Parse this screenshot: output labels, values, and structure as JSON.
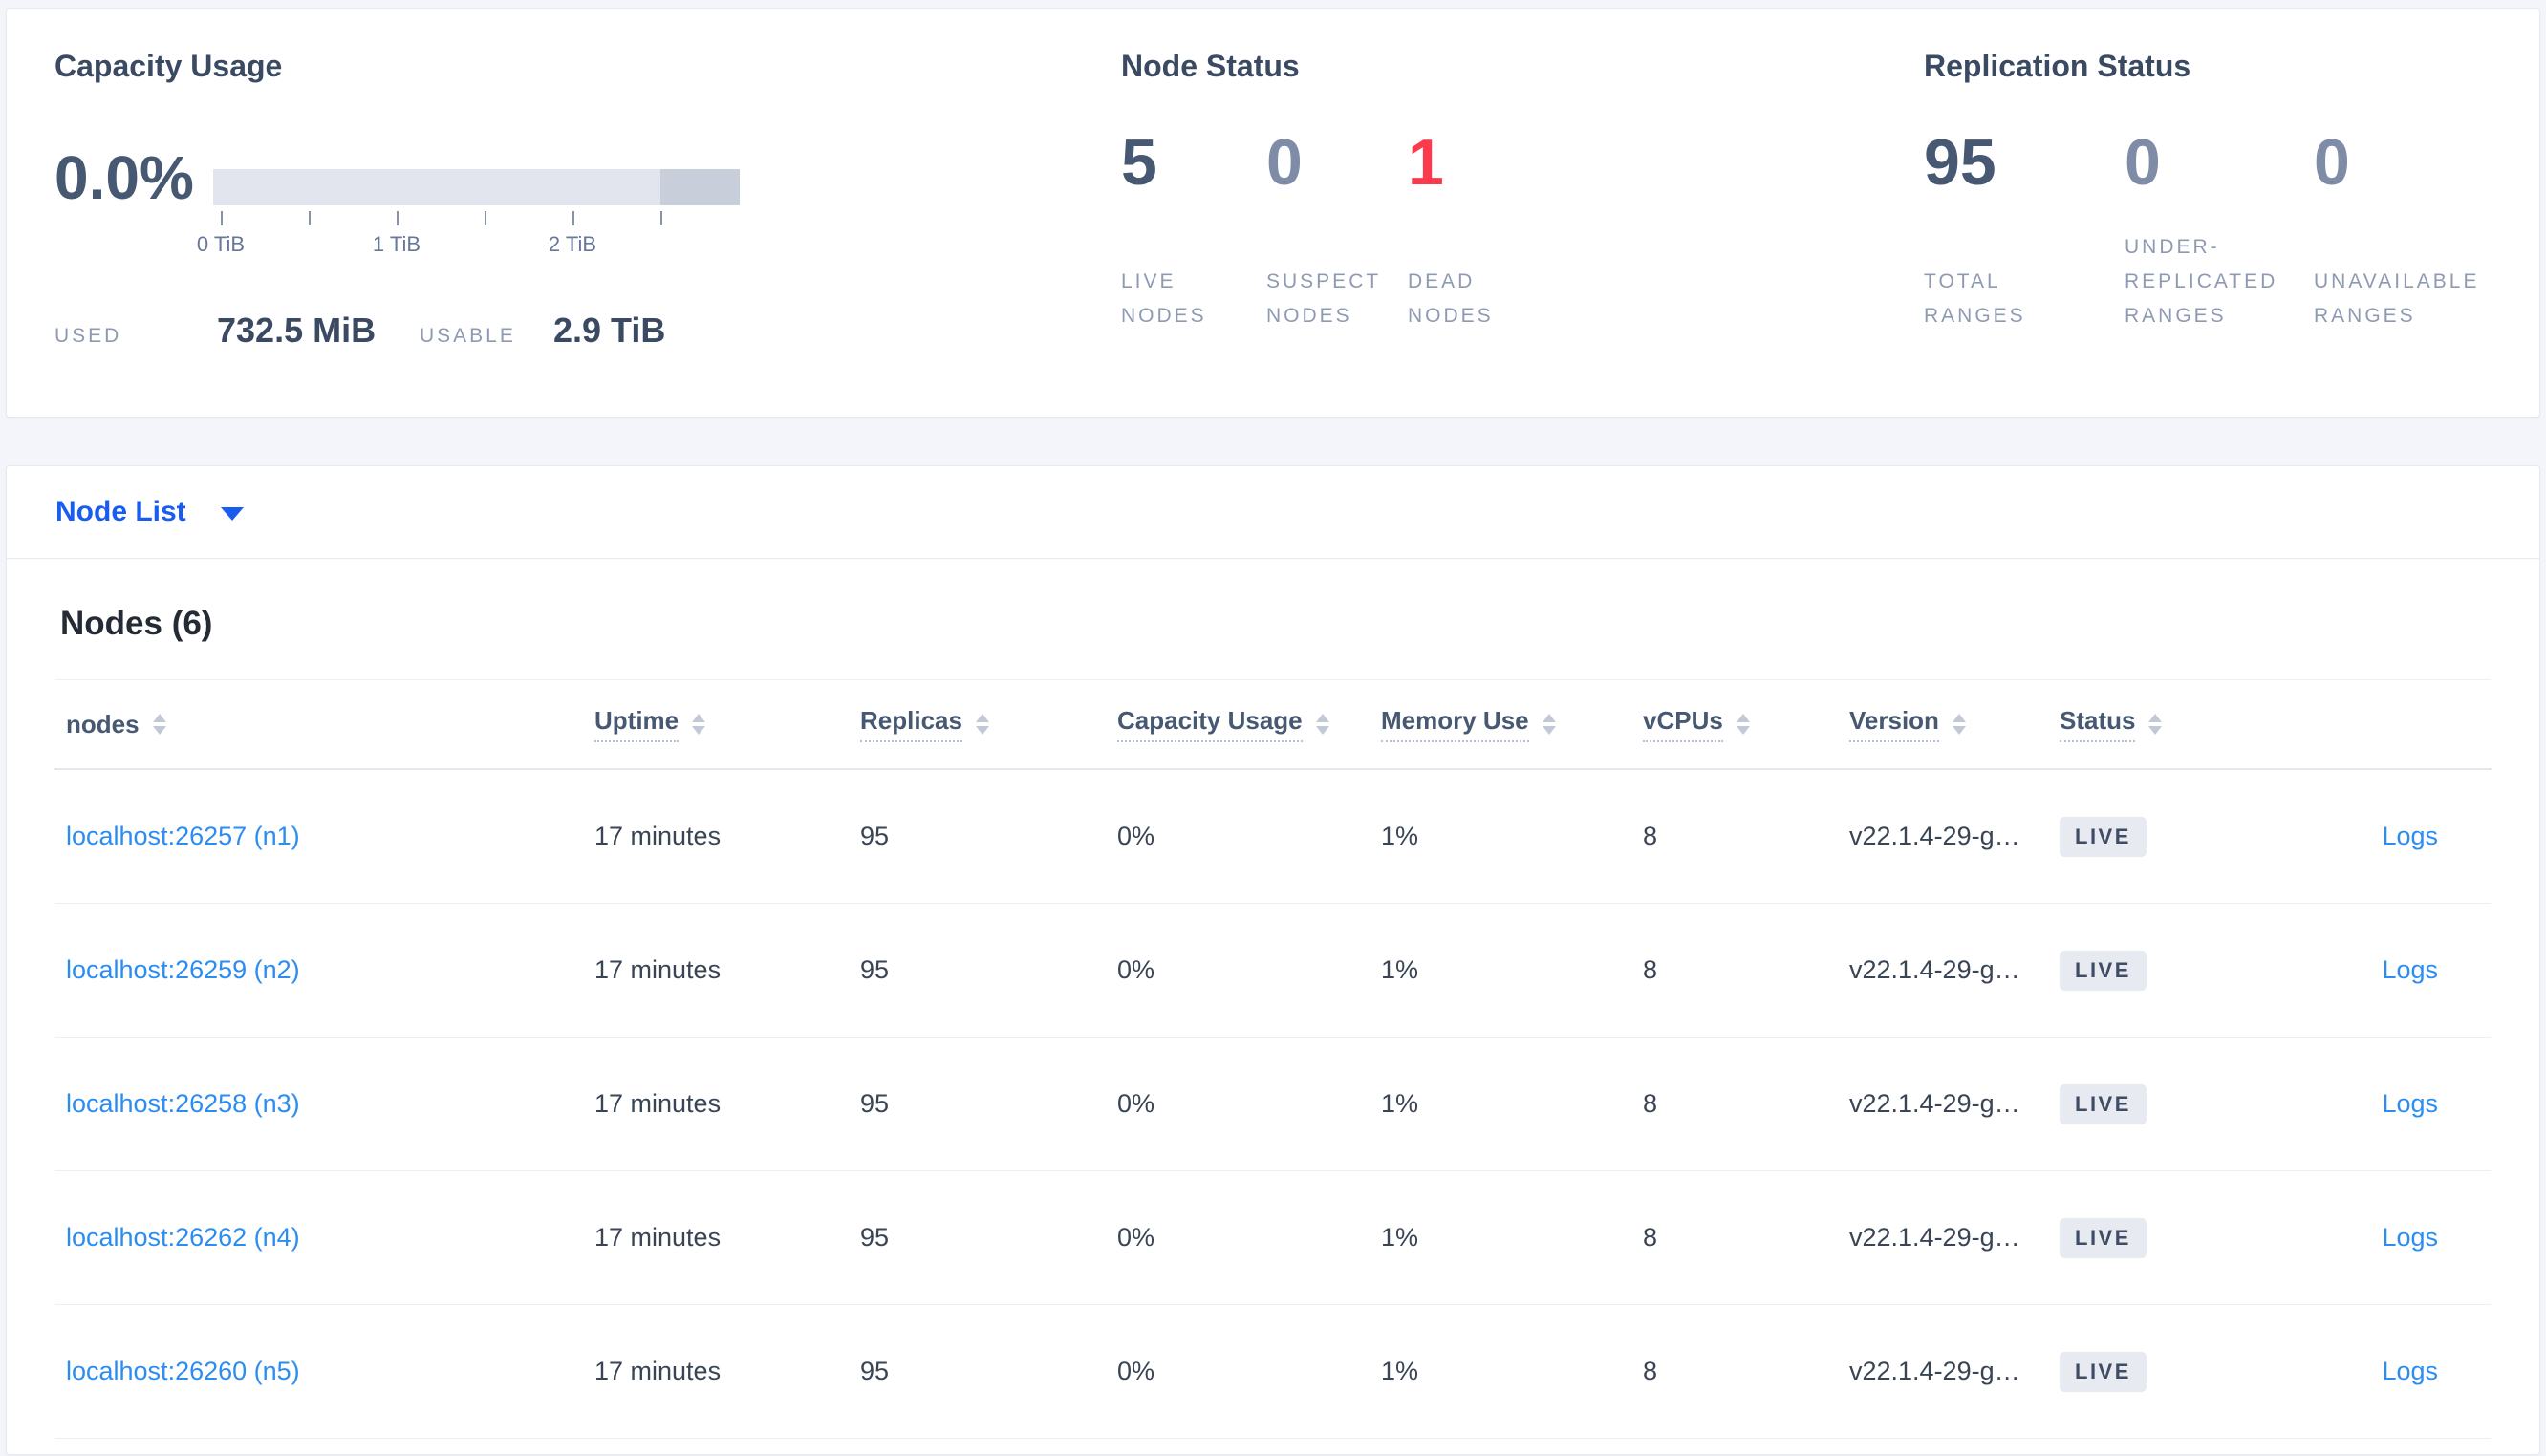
{
  "summary": {
    "capacity": {
      "title": "Capacity Usage",
      "percent": "0.0%",
      "axis_ticks": [
        "0 TiB",
        "1 TiB",
        "2 TiB"
      ],
      "used_label": "USED",
      "used_value": "732.5 MiB",
      "usable_label": "USABLE",
      "usable_value": "2.9 TiB"
    },
    "node_status": {
      "title": "Node Status",
      "stats": [
        {
          "value": "5",
          "label": "LIVE NODES",
          "tone": "dark"
        },
        {
          "value": "0",
          "label": "SUSPECT NODES",
          "tone": "muted"
        },
        {
          "value": "1",
          "label": "DEAD NODES",
          "tone": "danger"
        }
      ]
    },
    "replication_status": {
      "title": "Replication Status",
      "stats": [
        {
          "value": "95",
          "label": "TOTAL RANGES",
          "tone": "dark"
        },
        {
          "value": "0",
          "label": "UNDER-REPLICATED RANGES",
          "tone": "muted"
        },
        {
          "value": "0",
          "label": "UNAVAILABLE RANGES",
          "tone": "muted"
        }
      ]
    }
  },
  "node_list_dropdown": {
    "label": "Node List"
  },
  "nodes_table": {
    "title": "Nodes (6)",
    "columns": [
      {
        "label": "nodes",
        "underline": false
      },
      {
        "label": "Uptime",
        "underline": true
      },
      {
        "label": "Replicas",
        "underline": true
      },
      {
        "label": "Capacity Usage",
        "underline": true
      },
      {
        "label": "Memory Use",
        "underline": true
      },
      {
        "label": "vCPUs",
        "underline": true
      },
      {
        "label": "Version",
        "underline": true
      },
      {
        "label": "Status",
        "underline": true
      }
    ],
    "rows": [
      {
        "node": "localhost:26257 (n1)",
        "uptime": "17 minutes",
        "replicas": "95",
        "capacity_usage": "0%",
        "memory_use": "1%",
        "vcpus": "8",
        "version": "v22.1.4-29-g…",
        "status": "LIVE",
        "logs_label": "Logs"
      },
      {
        "node": "localhost:26259 (n2)",
        "uptime": "17 minutes",
        "replicas": "95",
        "capacity_usage": "0%",
        "memory_use": "1%",
        "vcpus": "8",
        "version": "v22.1.4-29-g…",
        "status": "LIVE",
        "logs_label": "Logs"
      },
      {
        "node": "localhost:26258 (n3)",
        "uptime": "17 minutes",
        "replicas": "95",
        "capacity_usage": "0%",
        "memory_use": "1%",
        "vcpus": "8",
        "version": "v22.1.4-29-g…",
        "status": "LIVE",
        "logs_label": "Logs"
      },
      {
        "node": "localhost:26262 (n4)",
        "uptime": "17 minutes",
        "replicas": "95",
        "capacity_usage": "0%",
        "memory_use": "1%",
        "vcpus": "8",
        "version": "v22.1.4-29-g…",
        "status": "LIVE",
        "logs_label": "Logs"
      },
      {
        "node": "localhost:26260 (n5)",
        "uptime": "17 minutes",
        "replicas": "95",
        "capacity_usage": "0%",
        "memory_use": "1%",
        "vcpus": "8",
        "version": "v22.1.4-29-g…",
        "status": "LIVE",
        "logs_label": "Logs"
      }
    ]
  },
  "colors": {
    "accent_blue": "#1a5cf0",
    "link_blue": "#2b8df0",
    "danger_red": "#fb3a4e",
    "dark_slate": "#475872",
    "muted_slate": "#7e8ca8",
    "badge_bg": "#e7eaf1",
    "bar_light": "#e2e5ee",
    "bar_dark": "#c9cedb",
    "page_bg": "#f4f5fa"
  }
}
